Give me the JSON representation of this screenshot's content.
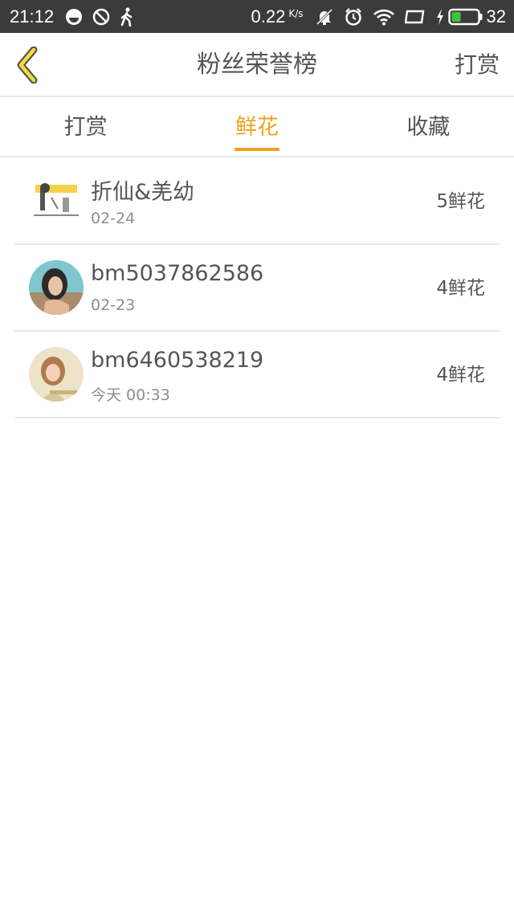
{
  "status_bar": {
    "time": "21:12",
    "net_speed": "0.22",
    "net_unit": "K/s",
    "battery": "32"
  },
  "header": {
    "title": "粉丝荣誉榜",
    "action_label": "打赏",
    "back_icon": "chevron-left-icon",
    "accent_color": "#f0a21e"
  },
  "tabs": [
    {
      "label": "打赏",
      "active": false
    },
    {
      "label": "鲜花",
      "active": true
    },
    {
      "label": "收藏",
      "active": false
    }
  ],
  "fans": [
    {
      "name": "折仙&羌幼",
      "date": "02-24",
      "amount": "5鲜花"
    },
    {
      "name": "bm5037862586",
      "date": "02-23",
      "amount": "4鲜花"
    },
    {
      "name": "bm6460538219",
      "date": "今天 00:33",
      "amount": "4鲜花"
    }
  ]
}
